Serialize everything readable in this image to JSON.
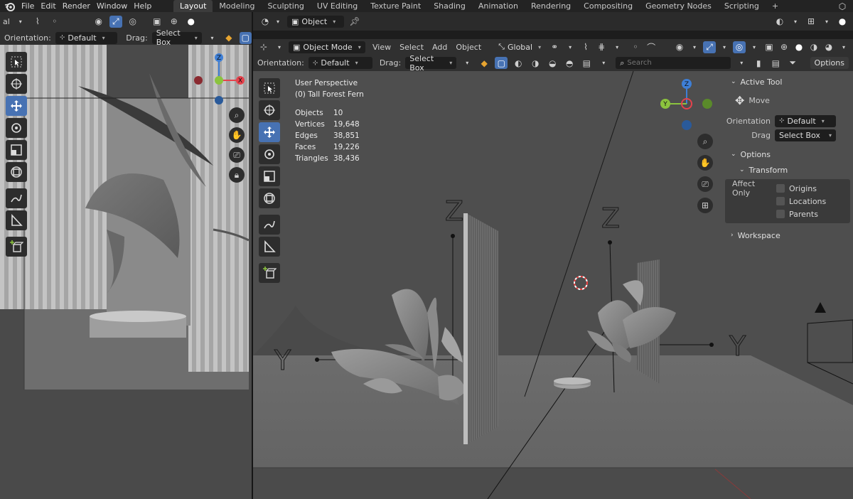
{
  "menubar": {
    "items": [
      "File",
      "Edit",
      "Render",
      "Window",
      "Help"
    ]
  },
  "workspaces": [
    "Layout",
    "Modeling",
    "Sculpting",
    "UV Editing",
    "Texture Paint",
    "Shading",
    "Animation",
    "Rendering",
    "Compositing",
    "Geometry Nodes",
    "Scripting",
    "+"
  ],
  "left_header": {
    "truncated_mode": "al"
  },
  "left_tool": {
    "orientation_label": "Orientation:",
    "orientation_value": "Default",
    "drag_label": "Drag:",
    "drag_value": "Select Box"
  },
  "right_header1": {
    "object_label": "Object"
  },
  "right_header2": {
    "mode": "Object Mode",
    "menus": [
      "View",
      "Select",
      "Add",
      "Object"
    ],
    "transform": "Global"
  },
  "right_tool": {
    "orientation_label": "Orientation:",
    "orientation_value": "Default",
    "drag_label": "Drag:",
    "drag_value": "Select Box",
    "search_placeholder": "Search",
    "options_label": "Options"
  },
  "viewport_overlay": {
    "view_name": "User Perspective",
    "active_object": "(0) Tall Forest Fern",
    "stats": [
      {
        "key": "Objects",
        "value": "10"
      },
      {
        "key": "Vertices",
        "value": "19,648"
      },
      {
        "key": "Edges",
        "value": "38,851"
      },
      {
        "key": "Faces",
        "value": "19,226"
      },
      {
        "key": "Triangles",
        "value": "38,436"
      }
    ]
  },
  "axis_letters": {
    "z": "Z",
    "y": "Y",
    "x": "X"
  },
  "npanel": {
    "active_tool": "Active Tool",
    "tool_name": "Move",
    "orientation_label": "Orientation",
    "orientation_value": "Default",
    "drag_label": "Drag",
    "drag_value": "Select Box",
    "options": "Options",
    "transform": "Transform",
    "affect_only": "Affect Only",
    "origins": "Origins",
    "locations": "Locations",
    "parents": "Parents",
    "workspace": "Workspace"
  },
  "colors": {
    "accent": "#4772b3",
    "x_axis": "#e6424c",
    "y_axis": "#8bc33e",
    "z_axis": "#3e7fd6"
  }
}
